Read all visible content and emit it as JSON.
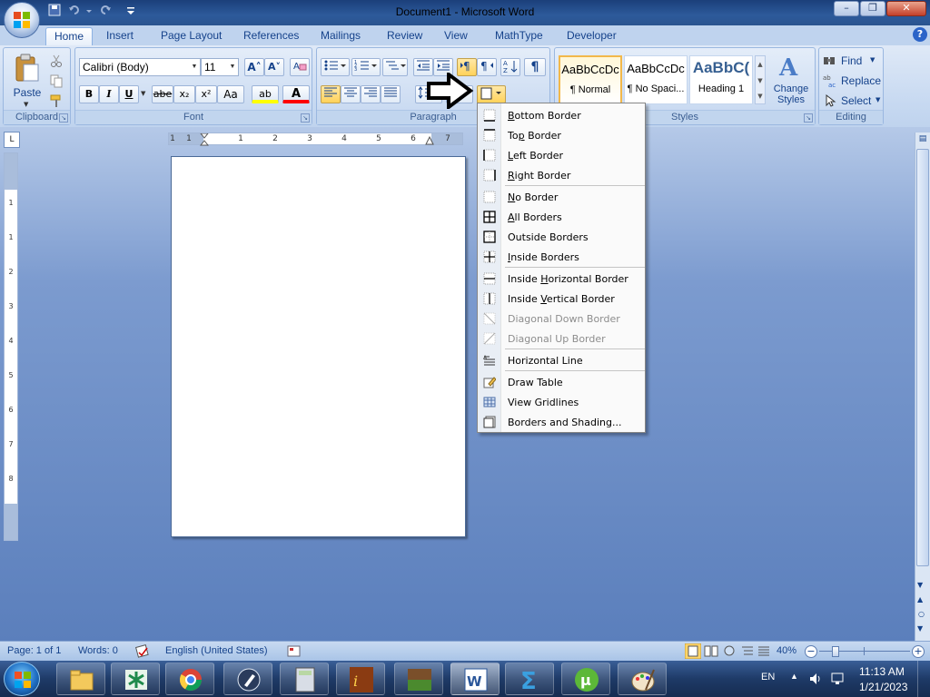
{
  "window": {
    "title_doc": "Document1",
    "title_sep": " - ",
    "title_app": "Microsoft Word",
    "min": "–",
    "max": "❐",
    "close": "✕"
  },
  "tabs": [
    {
      "label": "Home",
      "active": true
    },
    {
      "label": "Insert"
    },
    {
      "label": "Page Layout"
    },
    {
      "label": "References"
    },
    {
      "label": "Mailings"
    },
    {
      "label": "Review"
    },
    {
      "label": "View"
    },
    {
      "label": "MathType"
    },
    {
      "label": "Developer"
    }
  ],
  "help": "?",
  "ribbon": {
    "clipboard": {
      "label": "Clipboard",
      "paste": "Paste"
    },
    "font": {
      "label": "Font",
      "family": "Calibri (Body)",
      "size": "11",
      "grow": "A˄",
      "shrink": "A˅",
      "bold": "B",
      "italic": "I",
      "underline": "U",
      "strike": "abe",
      "subscript": "x₂",
      "superscript": "x²",
      "case": "Aa",
      "highlight": "ab",
      "color": "A"
    },
    "paragraph": {
      "label": "Paragraph",
      "pilcrow": "¶"
    },
    "styles": {
      "label": "Styles",
      "items": [
        {
          "sample": "AaBbCcDc",
          "name": "¶ Normal"
        },
        {
          "sample": "AaBbCcDc",
          "name": "¶ No Spaci..."
        },
        {
          "sample": "AaBbC(",
          "name": "Heading 1"
        }
      ],
      "change_line1": "Change",
      "change_line2": "Styles"
    },
    "editing": {
      "label": "Editing",
      "find": "Find",
      "replace": "Replace",
      "select": "Select"
    }
  },
  "ruler": {
    "h_numbers": [
      "1",
      "1",
      "1",
      "2",
      "3",
      "4",
      "5",
      "6",
      "7"
    ],
    "v_numbers": [
      "1",
      "1",
      "2",
      "3",
      "4",
      "5",
      "6",
      "7",
      "8"
    ]
  },
  "border_menu": {
    "items": [
      {
        "label": "Bottom Border",
        "u": "B"
      },
      {
        "label": "Top Border",
        "u": "p"
      },
      {
        "label": "Left Border",
        "u": "L"
      },
      {
        "label": "Right Border",
        "u": "R"
      },
      {
        "label": "No Border",
        "u": "N"
      },
      {
        "label": "All Borders",
        "u": "A"
      },
      {
        "label": "Outside Borders",
        "u": "S"
      },
      {
        "label": "Inside Borders",
        "u": "I"
      },
      {
        "label": "Inside Horizontal Border",
        "u": "H"
      },
      {
        "label": "Inside Vertical Border",
        "u": "V"
      },
      {
        "label": "Diagonal Down Border",
        "disabled": true
      },
      {
        "label": "Diagonal Up Border",
        "disabled": true
      },
      {
        "label": "Horizontal Line"
      },
      {
        "label": "Draw Table"
      },
      {
        "label": "View Gridlines"
      },
      {
        "label": "Borders and Shading..."
      }
    ]
  },
  "status": {
    "page": "Page: 1 of 1",
    "words": "Words: 0",
    "language": "English (United States)",
    "zoom": "40%"
  },
  "taskbar": {
    "lang": "EN",
    "time": "11:13 AM",
    "date": "1/21/2023"
  }
}
